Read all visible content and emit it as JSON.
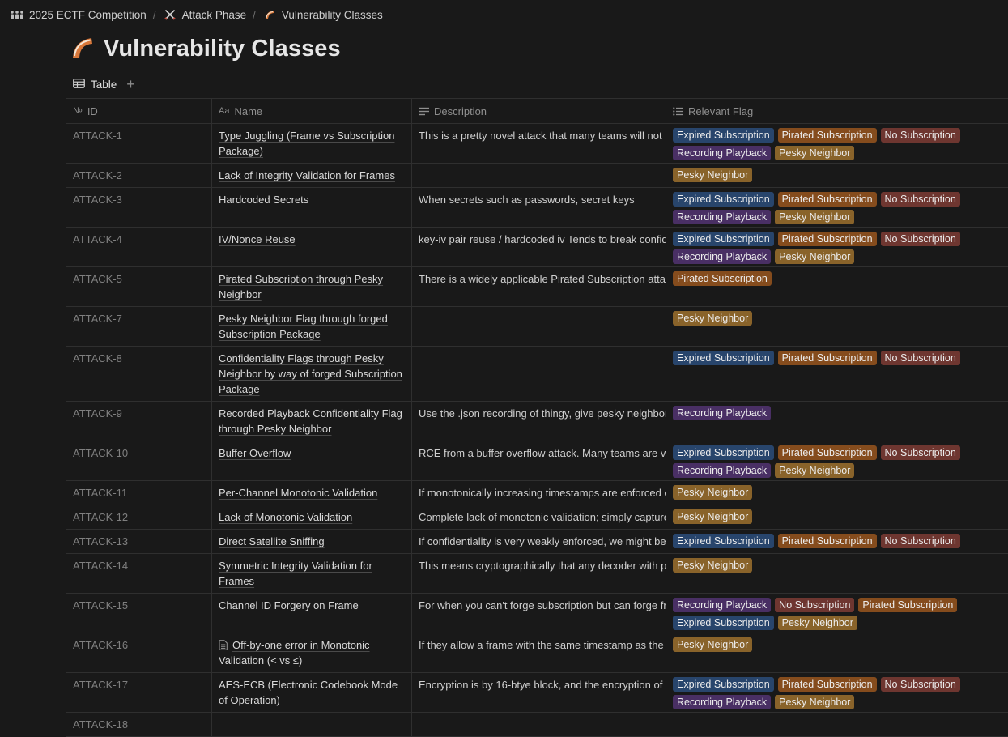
{
  "breadcrumb": [
    {
      "label": "2025 ECTF Competition",
      "icon": "people-icon"
    },
    {
      "label": "Attack Phase",
      "icon": "crossed-swords-icon"
    },
    {
      "label": "Vulnerability Classes",
      "icon": "boomerang-icon"
    }
  ],
  "page": {
    "title": "Vulnerability Classes",
    "icon": "boomerang-icon"
  },
  "view": {
    "tab_label": "Table",
    "add_label": "+"
  },
  "columns": {
    "id": "ID",
    "name": "Name",
    "description": "Description",
    "flag": "Relevant Flag"
  },
  "tag_colors": {
    "Expired Subscription": "#28456c",
    "Pirated Subscription": "#854c1d",
    "No Subscription": "#6e3630",
    "Recording Playback": "#492f64",
    "Pesky Neighbor": "#89632a"
  },
  "rows": [
    {
      "id": "ATTACK-1",
      "name": "Type Juggling (Frame vs Subscription Package)",
      "description": "This is a pretty novel attack that many teams will not find",
      "flags": [
        "Expired Subscription",
        "Pirated Subscription",
        "No Subscription",
        "Recording Playback",
        "Pesky Neighbor"
      ]
    },
    {
      "id": "ATTACK-2",
      "name": "Lack of Integrity Validation for Frames",
      "description": "",
      "flags": [
        "Pesky Neighbor"
      ]
    },
    {
      "id": "ATTACK-3",
      "name": "Hardcoded Secrets",
      "plain": true,
      "description": "When secrets such as passwords, secret keys",
      "flags": [
        "Expired Subscription",
        "Pirated Subscription",
        "No Subscription",
        "Recording Playback",
        "Pesky Neighbor"
      ]
    },
    {
      "id": "ATTACK-4",
      "name": "IV/Nonce Reuse",
      "description": "key-iv pair reuse / hardcoded iv Tends to break confidentiality",
      "flags": [
        "Expired Subscription",
        "Pirated Subscription",
        "No Subscription",
        "Recording Playback",
        "Pesky Neighbor"
      ]
    },
    {
      "id": "ATTACK-5",
      "name": "Pirated Subscription through Pesky Neighbor",
      "description": "There is a widely applicable Pirated Subscription attack",
      "flags": [
        "Pirated Subscription"
      ]
    },
    {
      "id": "ATTACK-7",
      "name": "Pesky Neighbor Flag through forged Subscription Package",
      "description": "",
      "flags": [
        "Pesky Neighbor"
      ]
    },
    {
      "id": "ATTACK-8",
      "name": "Confidentiality Flags through Pesky Neighbor by way of forged Subscription Package",
      "description": "",
      "flags": [
        "Expired Subscription",
        "Pirated Subscription",
        "No Subscription"
      ]
    },
    {
      "id": "ATTACK-9",
      "name": "Recorded Playback Confidentiality Flag through Pesky Neighbor",
      "description": "Use the .json recording of thingy, give pesky neighbor for",
      "flags": [
        "Recording Playback"
      ]
    },
    {
      "id": "ATTACK-10",
      "name": "Buffer Overflow",
      "description": "RCE from a buffer overflow attack. Many teams are vulnerable",
      "flags": [
        "Expired Subscription",
        "Pirated Subscription",
        "No Subscription",
        "Recording Playback",
        "Pesky Neighbor"
      ]
    },
    {
      "id": "ATTACK-11",
      "name": "Per-Channel Monotonic Validation",
      "description": "If monotonically increasing timestamps are enforced on",
      "flags": [
        "Pesky Neighbor"
      ]
    },
    {
      "id": "ATTACK-12",
      "name": "Lack of Monotonic Validation",
      "description": "Complete lack of monotonic validation; simply capture the",
      "flags": [
        "Pesky Neighbor"
      ]
    },
    {
      "id": "ATTACK-13",
      "name": "Direct Satellite Sniffing",
      "description": "If confidentiality is very weakly enforced, we might be able",
      "flags": [
        "Expired Subscription",
        "Pirated Subscription",
        "No Subscription"
      ]
    },
    {
      "id": "ATTACK-14",
      "name": "Symmetric Integrity Validation for Frames",
      "description": "This means cryptographically that any decoder with permission",
      "flags": [
        "Pesky Neighbor"
      ]
    },
    {
      "id": "ATTACK-15",
      "name": "Channel ID Forgery on Frame",
      "plain": true,
      "description": "For when you can't forge subscription but can forge frames",
      "flags": [
        "Recording Playback",
        "No Subscription",
        "Pirated Subscription",
        "Expired Subscription",
        "Pesky Neighbor"
      ]
    },
    {
      "id": "ATTACK-16",
      "name": "Off-by-one error in Monotonic Validation (< vs ≤)",
      "doc": true,
      "description": "If they allow a frame with the same timestamp as the previous",
      "flags": [
        "Pesky Neighbor"
      ]
    },
    {
      "id": "ATTACK-17",
      "name": "AES-ECB (Electronic Codebook Mode of Operation)",
      "plain": true,
      "description": "Encryption is by 16-btye block, and the encryption of two",
      "flags": [
        "Expired Subscription",
        "Pirated Subscription",
        "No Subscription",
        "Recording Playback",
        "Pesky Neighbor"
      ]
    },
    {
      "id": "ATTACK-18",
      "name": "",
      "description": "",
      "flags": []
    }
  ]
}
